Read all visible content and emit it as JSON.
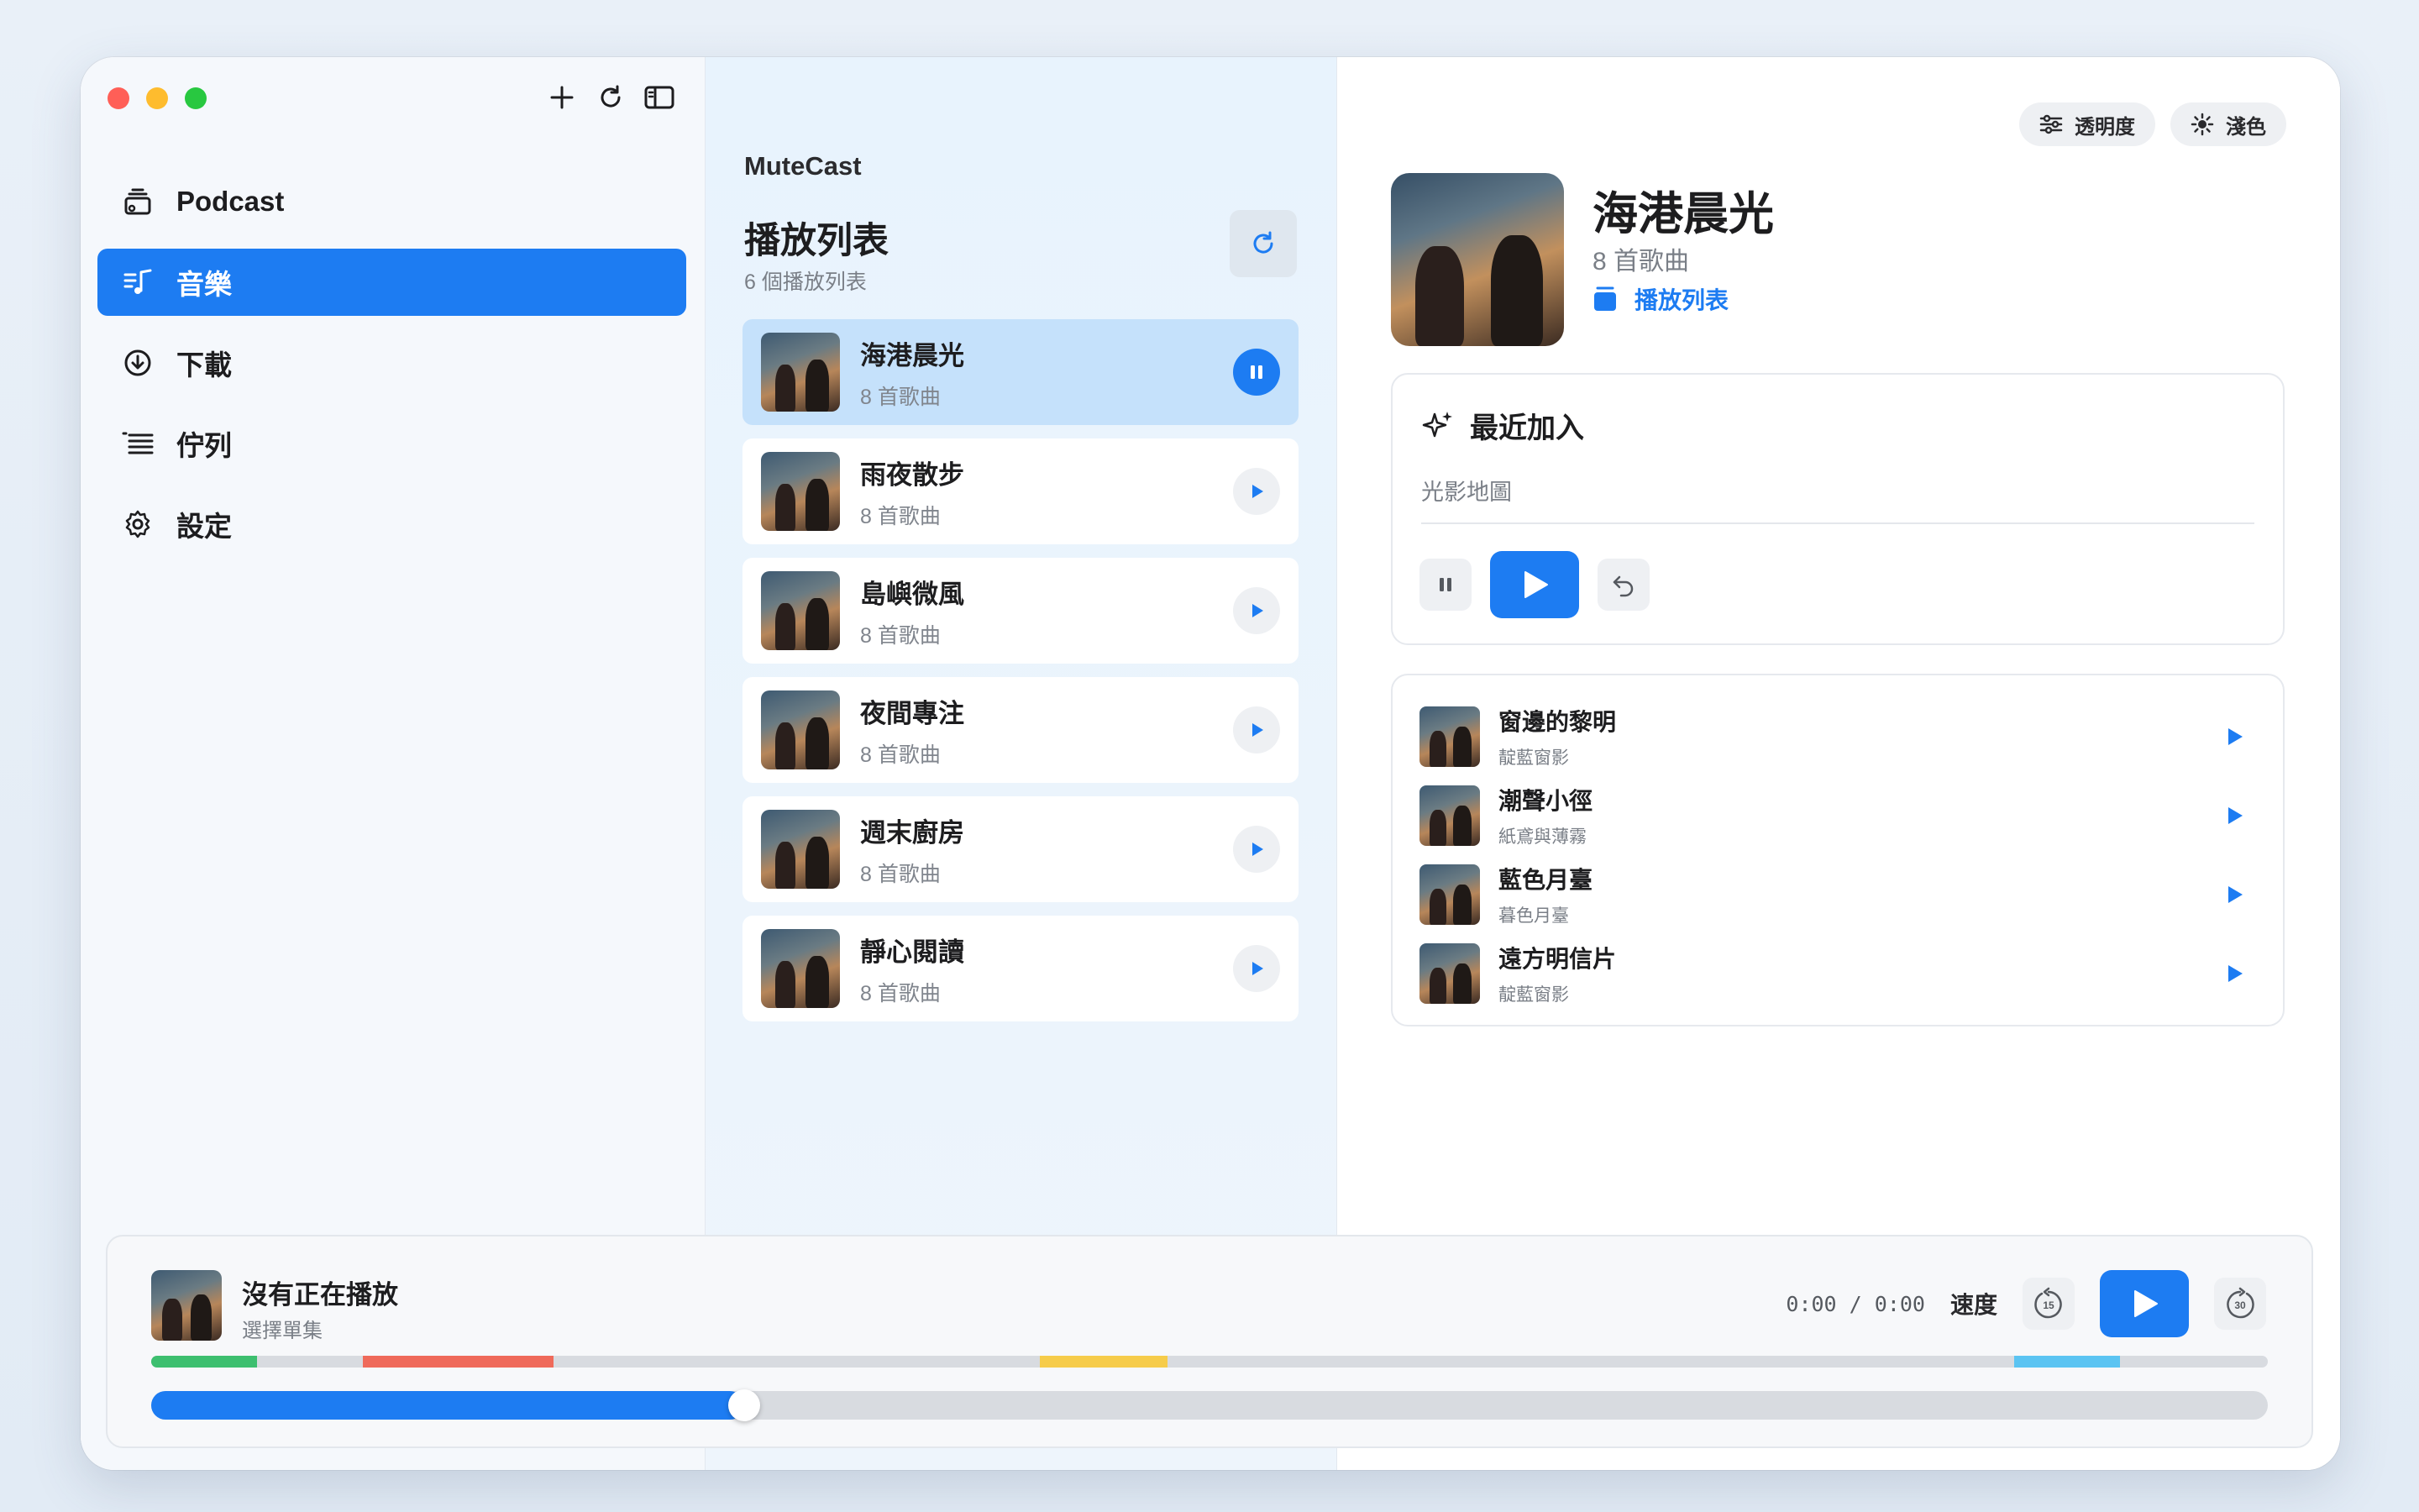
{
  "app": {
    "name": "MuteCast"
  },
  "sidebar": {
    "items": [
      {
        "label": "Podcast",
        "icon": "podcast-stack-icon",
        "active": false
      },
      {
        "label": "音樂",
        "icon": "music-list-icon",
        "active": true
      },
      {
        "label": "下載",
        "icon": "download-circle-icon",
        "active": false
      },
      {
        "label": "佇列",
        "icon": "queue-list-icon",
        "active": false
      },
      {
        "label": "設定",
        "icon": "gear-icon",
        "active": false
      }
    ]
  },
  "playlists": {
    "title": "播放列表",
    "subtitle": "6 個播放列表",
    "items": [
      {
        "name": "海港晨光",
        "count": "8 首歌曲",
        "playing": true
      },
      {
        "name": "雨夜散步",
        "count": "8 首歌曲",
        "playing": false
      },
      {
        "name": "島嶼微風",
        "count": "8 首歌曲",
        "playing": false
      },
      {
        "name": "夜間專注",
        "count": "8 首歌曲",
        "playing": false
      },
      {
        "name": "週末廚房",
        "count": "8 首歌曲",
        "playing": false
      },
      {
        "name": "靜心閱讀",
        "count": "8 首歌曲",
        "playing": false
      }
    ]
  },
  "detail": {
    "pills": {
      "opacity": "透明度",
      "theme": "淺色"
    },
    "title": "海港晨光",
    "subtitle": "8 首歌曲",
    "type_label": "播放列表",
    "recent": {
      "heading": "最近加入",
      "item": "光影地圖"
    },
    "tracks": [
      {
        "name": "窗邊的黎明",
        "artist": "靛藍窗影"
      },
      {
        "name": "潮聲小徑",
        "artist": "紙鳶與薄霧"
      },
      {
        "name": "藍色月臺",
        "artist": "暮色月臺"
      },
      {
        "name": "遠方明信片",
        "artist": "靛藍窗影"
      }
    ]
  },
  "player": {
    "title": "沒有正在播放",
    "subtitle": "選擇單集",
    "time": "0:00 / 0:00",
    "speed_label": "速度",
    "skip_back": "15",
    "skip_forward": "30",
    "progress": 0.28,
    "chapters": [
      {
        "start": 0.0,
        "end": 0.05,
        "color": "#3dbf6f"
      },
      {
        "start": 0.1,
        "end": 0.19,
        "color": "#ef6a5a"
      },
      {
        "start": 0.42,
        "end": 0.48,
        "color": "#f6cc4a"
      },
      {
        "start": 0.88,
        "end": 0.93,
        "color": "#5bc4f2"
      }
    ]
  },
  "colors": {
    "accent": "#1d7cf2",
    "active_row": "#c5e1fb"
  }
}
